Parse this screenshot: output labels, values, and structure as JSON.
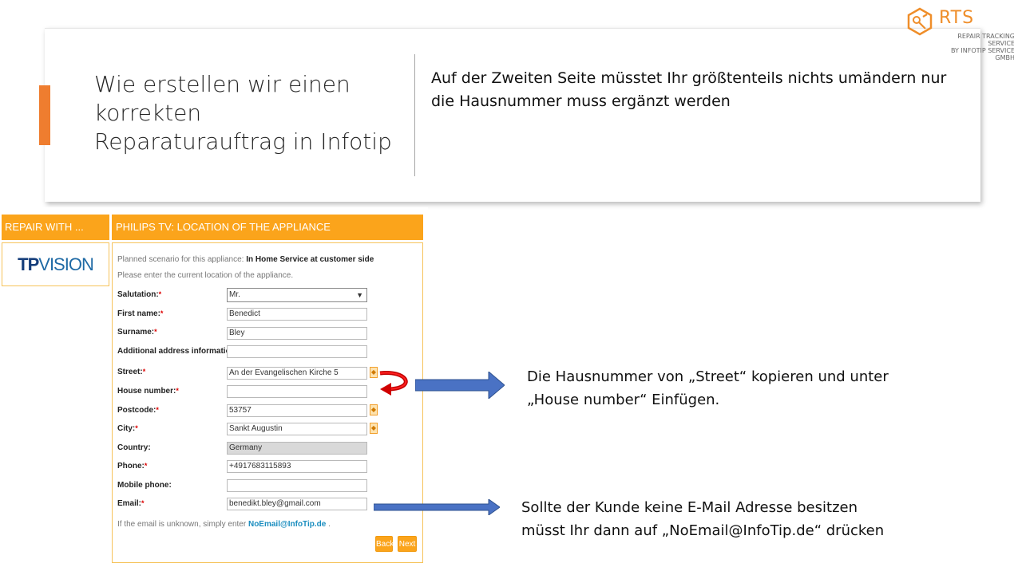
{
  "slide": {
    "title_lines": [
      "Wie erstellen wir einen",
      "korrekten",
      "Reparaturauftrag in Infotip"
    ],
    "body_lines": [
      "Auf der Zweiten Seite müsstet Ihr größtenteils nichts umändern nur",
      "die Hausnummer muss ergänzt werden"
    ]
  },
  "logo": {
    "name": "RTS",
    "sub_lines": [
      "REPAIR TRACKING SERVICE",
      "BY INFOTIP SERVICE GMBH"
    ],
    "color": "#ef8e2a"
  },
  "form": {
    "left_header": "REPAIR WITH ...",
    "brand_logo": {
      "bold": "TP",
      "rest": "VISION"
    },
    "main_header": "PHILIPS TV: LOCATION OF THE APPLIANCE",
    "intro_prefix": "Planned scenario for this appliance: ",
    "intro_scenario": "In Home Service at customer side",
    "intro_line2": "Please enter the current location of the appliance.",
    "required_mark": "*",
    "fields": {
      "salutation": {
        "label": "Salutation:",
        "value": "Mr."
      },
      "first_name": {
        "label": "First name:",
        "value": "Benedict"
      },
      "surname": {
        "label": "Surname:",
        "value": "Bley"
      },
      "additional": {
        "label": "Additional address information",
        "value": ""
      },
      "street": {
        "label": "Street:",
        "value": "An der Evangelischen Kirche 5"
      },
      "house_number": {
        "label": "House number:",
        "value": ""
      },
      "postcode": {
        "label": "Postcode:",
        "value": "53757"
      },
      "city": {
        "label": "City:",
        "value": "Sankt Augustin"
      },
      "country": {
        "label": "Country:",
        "value": "Germany"
      },
      "phone": {
        "label": "Phone:",
        "value": "+4917683115893"
      },
      "mobile": {
        "label": "Mobile phone:",
        "value": ""
      },
      "email": {
        "label": "Email:",
        "value": "benedikt.bley@gmail.com"
      }
    },
    "unknown_note_prefix": "If the email is unknown, simply enter ",
    "unknown_note_link": "NoEmail@InfoTip.de",
    "unknown_note_suffix": " .",
    "back_label": "Back",
    "next_label": "Next",
    "accent_color": "#fba41b"
  },
  "annotations": {
    "house_number_lines": [
      "Die Hausnummer von „Street“ kopieren und unter",
      "„House number“ Einfügen."
    ],
    "email_lines": [
      "Sollte der Kunde keine E-Mail Adresse besitzen",
      "müsst Ihr dann auf „NoEmail@InfoTip.de“ drücken"
    ]
  }
}
